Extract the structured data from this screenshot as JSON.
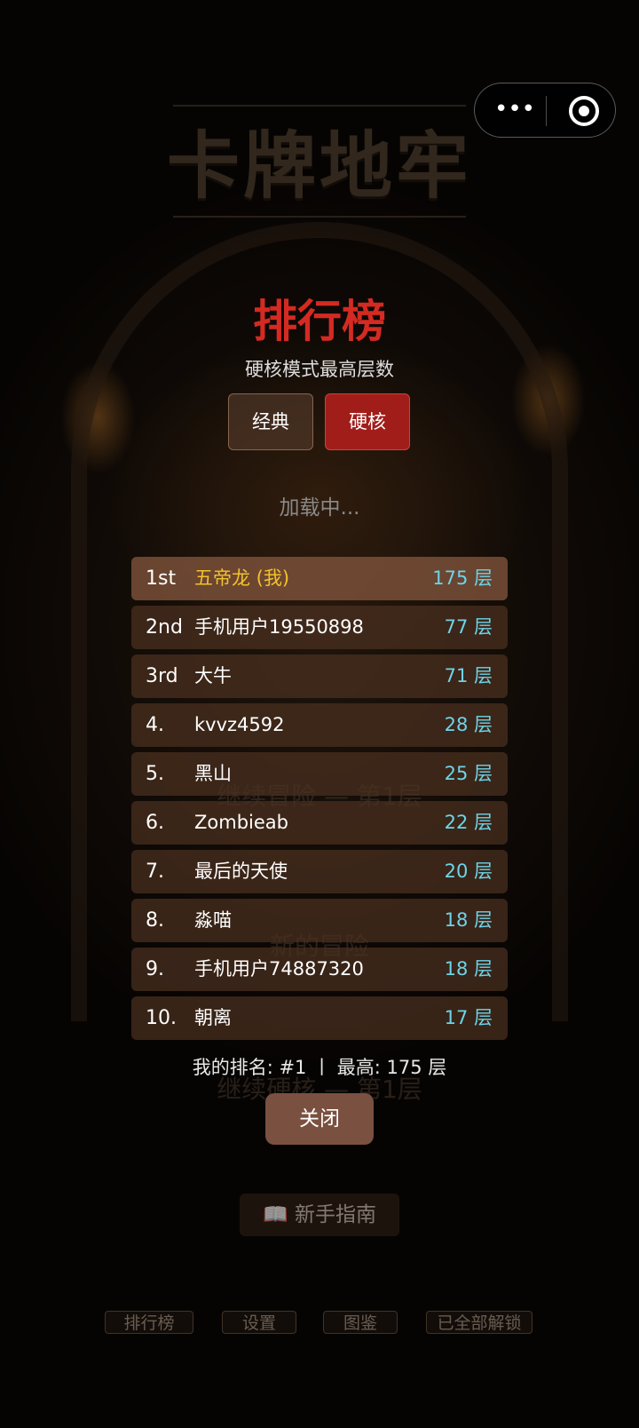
{
  "header": {
    "game_title": "卡牌地牢"
  },
  "background_menu": {
    "continue_adventure": "继续冒险 — 第1层",
    "new_adventure": "新的冒险",
    "continue_hardcore": "继续硬核 — 第1层",
    "guide": "📖 新手指南",
    "nav": [
      "排行榜",
      "设置",
      "图鉴",
      "已全部解锁"
    ]
  },
  "leaderboard": {
    "title": "排行榜",
    "subtitle": "硬核模式最高层数",
    "tabs": [
      {
        "label": "经典",
        "active": false
      },
      {
        "label": "硬核",
        "active": true
      }
    ],
    "loading_text": "加载中...",
    "entries": [
      {
        "rank": "1st",
        "name": "五帝龙 (我)",
        "score": "175 层",
        "is_me": true
      },
      {
        "rank": "2nd",
        "name": "手机用户19550898",
        "score": "77 层",
        "is_me": false
      },
      {
        "rank": "3rd",
        "name": "大牛",
        "score": "71 层",
        "is_me": false
      },
      {
        "rank": "4.",
        "name": "kvvz4592",
        "score": "28 层",
        "is_me": false
      },
      {
        "rank": "5.",
        "name": "黑山",
        "score": "25 层",
        "is_me": false
      },
      {
        "rank": "6.",
        "name": "Zombieab",
        "score": "22 层",
        "is_me": false
      },
      {
        "rank": "7.",
        "name": "最后的天使",
        "score": "20 层",
        "is_me": false
      },
      {
        "rank": "8.",
        "name": "淼喵",
        "score": "18 层",
        "is_me": false
      },
      {
        "rank": "9.",
        "name": "手机用户74887320",
        "score": "18 层",
        "is_me": false
      },
      {
        "rank": "10.",
        "name": "朝离",
        "score": "17 层",
        "is_me": false
      }
    ],
    "my_rank_text": "我的排名: #1 丨 最高: 175 层",
    "close_label": "关闭"
  },
  "colors": {
    "title_red": "#d42a22",
    "active_tab": "#a11d1a",
    "me_name": "#f2c22c",
    "score": "#6fd3e8",
    "close_button": "#7a5040"
  },
  "icons": {
    "capsule_menu": "more-dots-icon",
    "capsule_close": "target-icon",
    "guide": "book-icon"
  }
}
